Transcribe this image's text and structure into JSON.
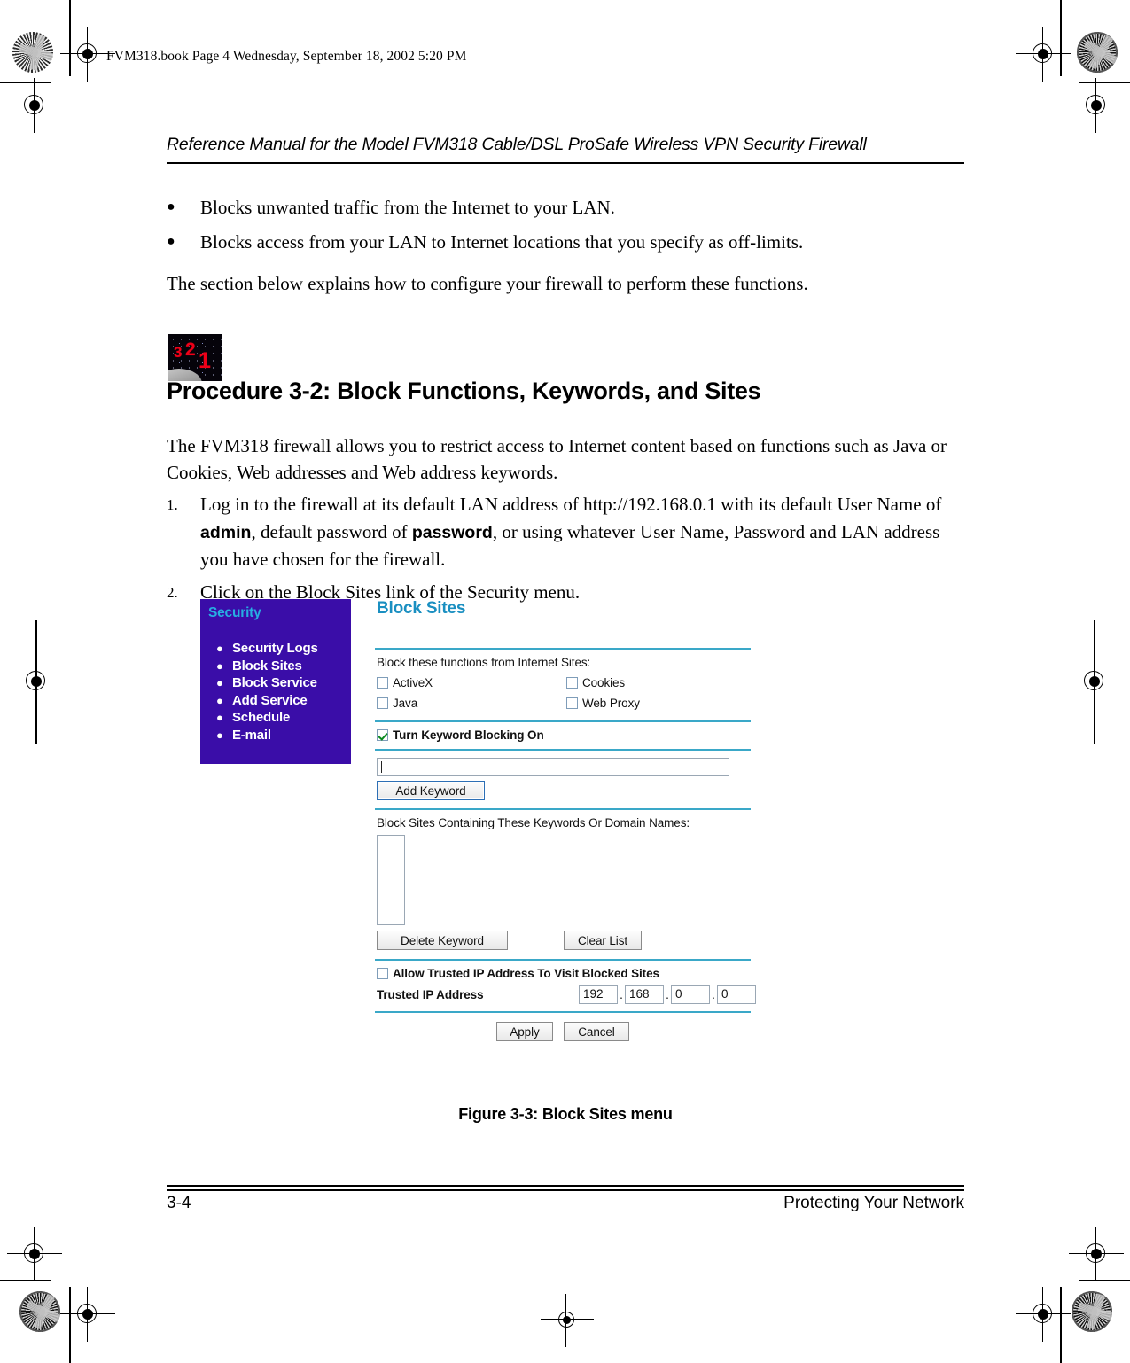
{
  "print_marks": {
    "book_header": "FVM318.book  Page 4  Wednesday, September 18, 2002  5:20 PM"
  },
  "running_head": "Reference Manual for the Model FVM318 Cable/DSL ProSafe Wireless VPN Security Firewall",
  "bullets": [
    "Blocks unwanted traffic from the Internet to your LAN.",
    "Blocks access from your LAN to Internet locations that you specify as off-limits."
  ],
  "intro_paragraph": "The section below explains how to configure your firewall to perform these functions.",
  "procedure": {
    "icon_numbers": [
      "3",
      "2",
      "1"
    ],
    "heading": "Procedure 3-2:  Block Functions, Keywords, and Sites",
    "body": "The FVM318 firewall allows you to restrict access to Internet content based on functions such as Java or Cookies, Web addresses and Web address keywords.",
    "steps": [
      {
        "number": "1.",
        "part1": "Log in to the firewall at its default LAN address of http://192.168.0.1 with its default User Name of ",
        "bold1": "admin",
        "part2": ", default password of ",
        "bold2": "password",
        "part3": ", or using whatever User Name, Password and LAN address you have chosen for the firewall."
      },
      {
        "number": "2.",
        "part1": "Click on the Block Sites link of the Security menu.",
        "bold1": "",
        "part2": "",
        "bold2": "",
        "part3": ""
      }
    ]
  },
  "figure": {
    "menu": {
      "title": "Security",
      "items": [
        "Security Logs",
        "Block Sites",
        "Block Service",
        "Add Service",
        "Schedule",
        "E-mail"
      ]
    },
    "panel_title": "Block Sites",
    "functions_label": "Block these functions from Internet Sites:",
    "function_checkboxes": [
      {
        "label": "ActiveX",
        "checked": false
      },
      {
        "label": "Java",
        "checked": false
      },
      {
        "label": "Cookies",
        "checked": false
      },
      {
        "label": "Web Proxy",
        "checked": false
      }
    ],
    "keyword_blocking": {
      "label": "Turn Keyword Blocking On",
      "checked": true
    },
    "keyword_input_value": "",
    "add_keyword_button": "Add Keyword",
    "keyword_list_label": "Block Sites Containing These Keywords Or Domain Names:",
    "keyword_list_items": [],
    "delete_keyword_button": "Delete Keyword",
    "clear_list_button": "Clear List",
    "trusted_ip": {
      "checkbox_label": "Allow Trusted IP Address To Visit Blocked Sites",
      "checked": false,
      "field_label": "Trusted IP Address",
      "octets": [
        "192",
        "168",
        "0",
        "0"
      ],
      "separator": "."
    },
    "apply_button": "Apply",
    "cancel_button": "Cancel",
    "colors": {
      "menu_background": "#3a0da8",
      "menu_title": "#27aee2",
      "panel_title": "#1a8fc1",
      "rule": "#3aa8c8",
      "checkmark": "#0a8a1f"
    }
  },
  "figure_caption": "Figure 3-3: Block Sites menu",
  "footer": {
    "page_number": "3-4",
    "chapter_title": "Protecting Your Network"
  }
}
